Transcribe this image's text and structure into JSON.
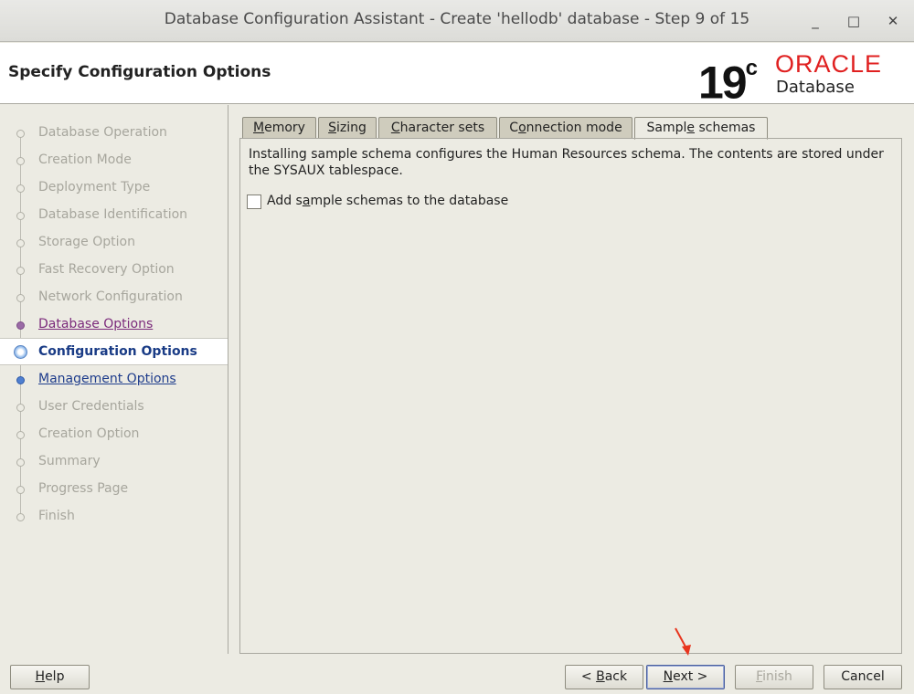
{
  "window": {
    "title": "Database Configuration Assistant - Create 'hellodb' database - Step 9 of 15",
    "controls": [
      "_",
      "□",
      "✕"
    ]
  },
  "header": {
    "page_title": "Specify Configuration Options",
    "logo_version": "19",
    "logo_version_sup": "c",
    "logo_brand": "ORACLE",
    "logo_product": "Database"
  },
  "nav": {
    "items": [
      {
        "label": "Database Operation",
        "state": "pending"
      },
      {
        "label": "Creation Mode",
        "state": "pending"
      },
      {
        "label": "Deployment Type",
        "state": "pending"
      },
      {
        "label": "Database Identification",
        "state": "pending"
      },
      {
        "label": "Storage Option",
        "state": "pending"
      },
      {
        "label": "Fast Recovery Option",
        "state": "pending"
      },
      {
        "label": "Network Configuration",
        "state": "pending"
      },
      {
        "label": "Database Options",
        "state": "visited"
      },
      {
        "label": "Configuration Options",
        "state": "current"
      },
      {
        "label": "Management Options",
        "state": "link"
      },
      {
        "label": "User Credentials",
        "state": "pending"
      },
      {
        "label": "Creation Option",
        "state": "pending"
      },
      {
        "label": "Summary",
        "state": "pending"
      },
      {
        "label": "Progress Page",
        "state": "pending"
      },
      {
        "label": "Finish",
        "state": "pending"
      }
    ]
  },
  "tabs": {
    "memory": {
      "pre": "",
      "mn": "M",
      "post": "emory"
    },
    "sizing": {
      "pre": "",
      "mn": "S",
      "post": "izing"
    },
    "charsets": {
      "pre": "",
      "mn": "C",
      "post": "haracter sets"
    },
    "connection": {
      "pre": "C",
      "mn": "o",
      "post": "nnection mode"
    },
    "sample": {
      "pre": "Sampl",
      "mn": "e",
      "post": " schemas"
    }
  },
  "content": {
    "description": "Installing sample schema configures the Human Resources schema. The contents are stored under the SYSAUX tablespace.",
    "checkbox_pre": "Add s",
    "checkbox_mn": "a",
    "checkbox_post": "mple schemas to the database",
    "checkbox_checked": false
  },
  "footer": {
    "help": {
      "pre": "",
      "mn": "H",
      "post": "elp"
    },
    "back": {
      "pre": "< ",
      "mn": "B",
      "post": "ack"
    },
    "next": {
      "pre": "",
      "mn": "N",
      "post": "ext >"
    },
    "finish": {
      "pre": "",
      "mn": "F",
      "post": "inish"
    },
    "cancel": "Cancel"
  },
  "colors": {
    "accent_link": "#1f3d8c",
    "visited_link": "#7b2a7b",
    "oracle_red": "#e02020",
    "annotation_arrow": "#e8351e"
  }
}
